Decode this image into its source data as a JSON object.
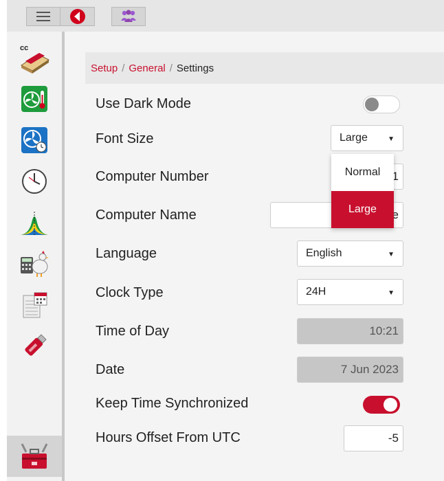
{
  "toolbar": {
    "menu_icon": "hamburger-icon",
    "back_icon": "back-arrow-icon",
    "users_icon": "users-icon"
  },
  "sidebar": {
    "items": [
      {
        "name": "house-cc-icon",
        "label": "cc"
      },
      {
        "name": "fan-thermometer-icon"
      },
      {
        "name": "fan-timer-icon"
      },
      {
        "name": "clock-icon"
      },
      {
        "name": "growth-curve-icon"
      },
      {
        "name": "chicken-calculator-icon"
      },
      {
        "name": "calendar-notes-icon"
      },
      {
        "name": "usb-drive-icon"
      },
      {
        "name": "toolbox-icon"
      }
    ]
  },
  "breadcrumb": {
    "part1": "Setup",
    "sep": "/",
    "part2": "General",
    "current": "Settings"
  },
  "settings": {
    "dark_mode": {
      "label": "Use Dark Mode",
      "value": false
    },
    "font_size": {
      "label": "Font Size",
      "value": "Large"
    },
    "computer_number": {
      "label": "Computer Number",
      "value": "1"
    },
    "computer_name": {
      "label": "Computer Name",
      "value": "e"
    },
    "language": {
      "label": "Language",
      "value": "English"
    },
    "clock_type": {
      "label": "Clock Type",
      "value": "24H"
    },
    "time_of_day": {
      "label": "Time of Day",
      "value": "10:21"
    },
    "date": {
      "label": "Date",
      "value": "7 Jun 2023"
    },
    "keep_time_sync": {
      "label": "Keep Time Synchronized",
      "value": true
    },
    "hours_offset": {
      "label": "Hours Offset From UTC",
      "value": "-5"
    }
  },
  "font_size_dropdown": {
    "options": [
      "Normal",
      "Large"
    ],
    "selected": "Large"
  },
  "colors": {
    "accent": "#c8102e",
    "readonly_bg": "#c6c6c6"
  }
}
